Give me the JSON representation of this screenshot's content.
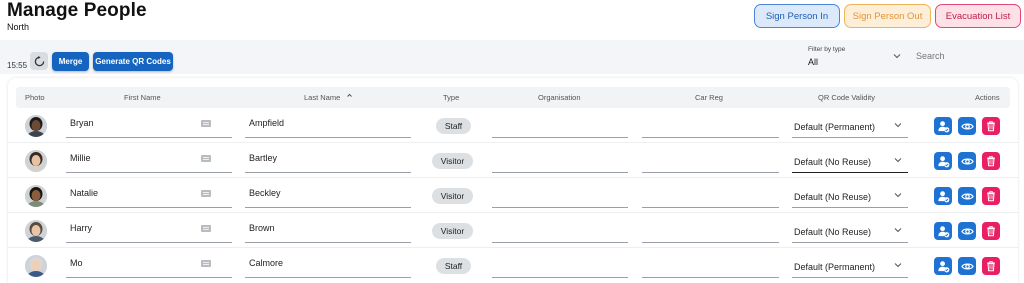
{
  "header": {
    "title": "Manage People",
    "subtitle": "North",
    "sign_in_label": "Sign Person In",
    "sign_out_label": "Sign Person Out",
    "evacuation_label": "Evacuation List"
  },
  "toolbar": {
    "time": "15:55",
    "merge_label": "Merge",
    "qr_label": "Generate QR Codes",
    "filter_label": "Filter by type",
    "filter_value": "All",
    "search_placeholder": "Search"
  },
  "table": {
    "columns": {
      "photo": "Photo",
      "first_name": "First Name",
      "last_name": "Last Name",
      "type": "Type",
      "organisation": "Organisation",
      "car_reg": "Car Reg",
      "qr_validity": "QR Code Validity",
      "actions": "Actions"
    },
    "sort": {
      "column": "Last Name",
      "direction": "ascending"
    },
    "rows": [
      {
        "first_name": "Bryan",
        "last_name": "Ampfield",
        "type": "Staff",
        "organisation": "",
        "car_reg": "",
        "qr_validity": "Default (Permanent)"
      },
      {
        "first_name": "Millie",
        "last_name": "Bartley",
        "type": "Visitor",
        "organisation": "",
        "car_reg": "",
        "qr_validity": "Default (No Reuse)"
      },
      {
        "first_name": "Natalie",
        "last_name": "Beckley",
        "type": "Visitor",
        "organisation": "",
        "car_reg": "",
        "qr_validity": "Default (No Reuse)"
      },
      {
        "first_name": "Harry",
        "last_name": "Brown",
        "type": "Visitor",
        "organisation": "",
        "car_reg": "",
        "qr_validity": "Default (No Reuse)"
      },
      {
        "first_name": "Mo",
        "last_name": "Calmore",
        "type": "Staff",
        "organisation": "",
        "car_reg": "",
        "qr_validity": "Default (Permanent)"
      }
    ]
  },
  "colors": {
    "primary": "#1565c0",
    "sign_in_border": "#4a88d6",
    "sign_out_border": "#f1b35a",
    "evacuation_border": "#e3487a",
    "delete": "#e91e63"
  },
  "icons": [
    "refresh-icon",
    "chevron-down-icon",
    "sort-up-icon",
    "keyboard-icon",
    "user-check-icon",
    "eye-icon",
    "trash-icon"
  ]
}
